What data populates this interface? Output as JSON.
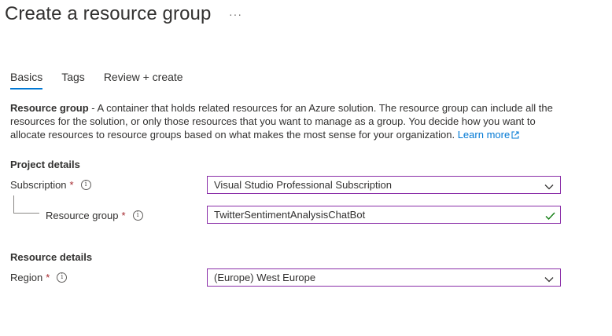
{
  "header": {
    "title": "Create a resource group",
    "more_label": "···"
  },
  "tabs": [
    {
      "label": "Basics",
      "selected": true
    },
    {
      "label": "Tags",
      "selected": false
    },
    {
      "label": "Review + create",
      "selected": false
    }
  ],
  "description": {
    "term": "Resource group",
    "text": " - A container that holds related resources for an Azure solution. The resource group can include all the resources for the solution, or only those resources that you want to manage as a group. You decide how you want to allocate resources to resource groups based on what makes the most sense for your organization. ",
    "link_label": "Learn more"
  },
  "project_details": {
    "heading": "Project details",
    "subscription": {
      "label": "Subscription",
      "required_mark": "*",
      "value": "Visual Studio Professional Subscription"
    },
    "resource_group": {
      "label": "Resource group",
      "required_mark": "*",
      "value": "TwitterSentimentAnalysisChatBot"
    }
  },
  "resource_details": {
    "heading": "Resource details",
    "region": {
      "label": "Region",
      "required_mark": "*",
      "value": "(Europe) West Europe"
    }
  },
  "colors": {
    "accent": "#0078d4",
    "field_border": "#8a2ea8",
    "required": "#a4262c",
    "valid": "#107c10"
  },
  "icons": {
    "info": "info-circle-icon",
    "dropdown": "chevron-down-icon",
    "valid": "checkmark-icon",
    "external": "external-link-icon"
  }
}
